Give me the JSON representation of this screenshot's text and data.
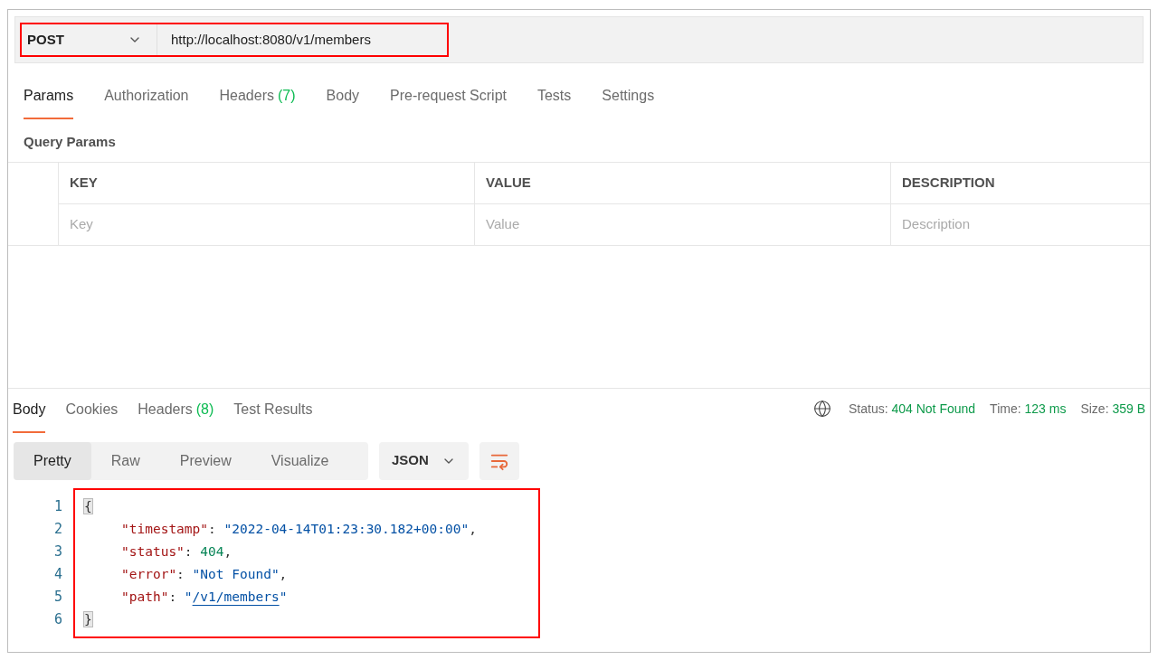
{
  "request": {
    "method": "POST",
    "url": "http://localhost:8080/v1/members"
  },
  "request_tabs": [
    {
      "label": "Params",
      "selected": true
    },
    {
      "label": "Authorization",
      "selected": false
    },
    {
      "label": "Headers",
      "count": "(7)",
      "selected": false
    },
    {
      "label": "Body",
      "selected": false
    },
    {
      "label": "Pre-request Script",
      "selected": false
    },
    {
      "label": "Tests",
      "selected": false
    },
    {
      "label": "Settings",
      "selected": false
    }
  ],
  "query_params": {
    "title": "Query Params",
    "columns": [
      "KEY",
      "VALUE",
      "DESCRIPTION"
    ],
    "placeholders": [
      "Key",
      "Value",
      "Description"
    ]
  },
  "response_tabs": [
    {
      "label": "Body",
      "selected": true
    },
    {
      "label": "Cookies",
      "selected": false
    },
    {
      "label": "Headers",
      "count": "(8)",
      "selected": false
    },
    {
      "label": "Test Results",
      "selected": false
    }
  ],
  "response_status": [
    {
      "label": "Status:",
      "value": "404 Not Found"
    },
    {
      "label": "Time:",
      "value": "123 ms"
    },
    {
      "label": "Size:",
      "value": "359 B"
    }
  ],
  "view_modes": [
    {
      "label": "Pretty",
      "selected": true
    },
    {
      "label": "Raw",
      "selected": false
    },
    {
      "label": "Preview",
      "selected": false
    },
    {
      "label": "Visualize",
      "selected": false
    }
  ],
  "format": "JSON",
  "code_lines": [
    {
      "number": "1",
      "indented": false,
      "tokens": [
        {
          "kind": "brace",
          "text": "{"
        }
      ]
    },
    {
      "number": "2",
      "indented": true,
      "tokens": [
        {
          "kind": "key",
          "text": "\"timestamp\""
        },
        {
          "kind": "punct",
          "text": ": "
        },
        {
          "kind": "string",
          "text": "\"2022-04-14T01:23:30.182+00:00\""
        },
        {
          "kind": "punct",
          "text": ","
        }
      ]
    },
    {
      "number": "3",
      "indented": true,
      "tokens": [
        {
          "kind": "key",
          "text": "\"status\""
        },
        {
          "kind": "punct",
          "text": ": "
        },
        {
          "kind": "number",
          "text": "404"
        },
        {
          "kind": "punct",
          "text": ","
        }
      ]
    },
    {
      "number": "4",
      "indented": true,
      "tokens": [
        {
          "kind": "key",
          "text": "\"error\""
        },
        {
          "kind": "punct",
          "text": ": "
        },
        {
          "kind": "string",
          "text": "\"Not Found\""
        },
        {
          "kind": "punct",
          "text": ","
        }
      ]
    },
    {
      "number": "5",
      "indented": true,
      "tokens": [
        {
          "kind": "key",
          "text": "\"path\""
        },
        {
          "kind": "punct",
          "text": ": "
        },
        {
          "kind": "string",
          "text": "\""
        },
        {
          "kind": "link",
          "text": "/v1/members"
        },
        {
          "kind": "string",
          "text": "\""
        }
      ]
    },
    {
      "number": "6",
      "indented": false,
      "tokens": [
        {
          "kind": "brace",
          "text": "}"
        }
      ]
    }
  ]
}
